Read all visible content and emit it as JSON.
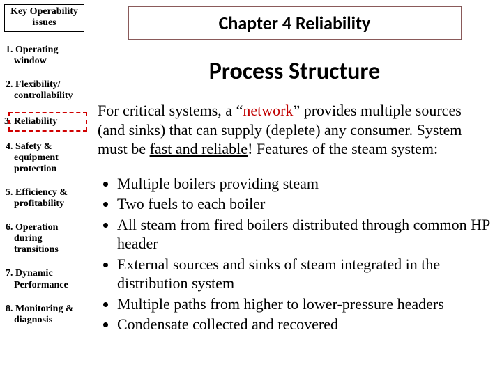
{
  "sidebar": {
    "title_line1": "Key Operability",
    "title_line2": "issues",
    "items": [
      "1. Operating window",
      "2. Flexibility/ controllability",
      "3. Reliability",
      "4. Safety & equipment protection",
      "5. Efficiency & profitability",
      "6. Operation during transitions",
      "7. Dynamic Performance",
      "8. Monitoring & diagnosis"
    ],
    "highlight_index": 2
  },
  "main": {
    "chapter_title": "Chapter 4 Reliability",
    "section_title": "Process Structure",
    "para_pre": "For critical systems, a “",
    "para_net": "network",
    "para_mid": "” provides multiple sources (and sinks) that can supply (deplete) any consumer.  System must be ",
    "para_ul": "fast and reliable",
    "para_post": "! Features of the steam system:",
    "bullets": [
      "Multiple boilers providing steam",
      "Two fuels to each boiler",
      "All steam from fired boilers distributed through common HP header",
      "External sources and sinks of steam integrated in the distribution system",
      "Multiple paths from higher to lower-pressure headers",
      "Condensate collected and recovered"
    ]
  }
}
